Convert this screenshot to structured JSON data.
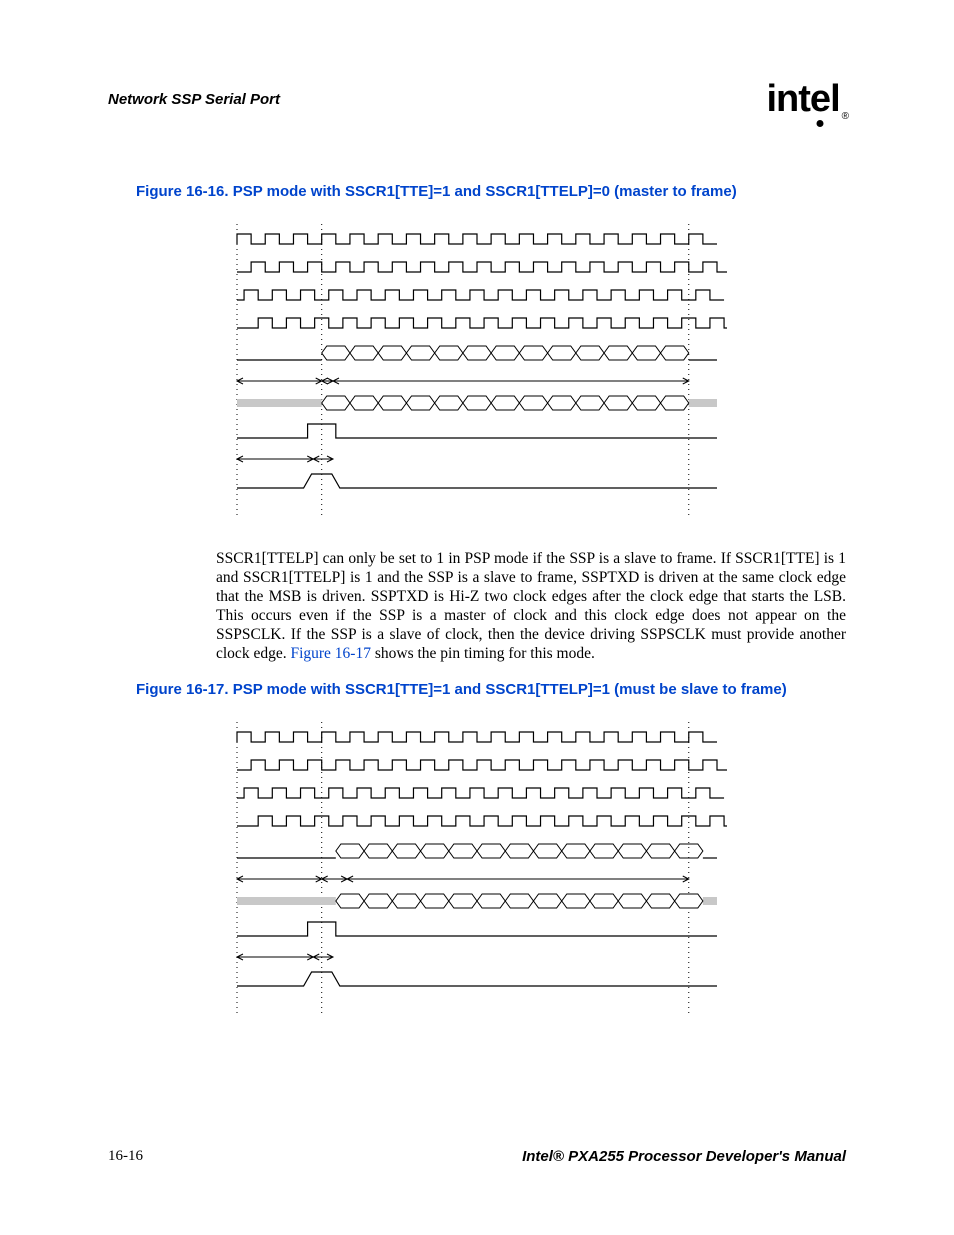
{
  "header": {
    "section_title": "Network SSP Serial Port",
    "logo_text": "intel",
    "logo_reg": "®"
  },
  "figure1": {
    "caption": "Figure 16-16. PSP mode with SSCR1[TTE]=1 and SSCR1[TTELP]=0 (master to frame)"
  },
  "paragraph": {
    "text_before_xref": "SSCR1[TTELP] can only be set to 1 in PSP mode if the SSP is a slave to frame. If SSCR1[TTE] is 1 and SSCR1[TTELP] is 1 and the SSP is a slave to frame, SSPTXD is driven at the same clock edge that the MSB is driven. SSPTXD is Hi-Z two clock edges after the clock edge that starts the LSB. This occurs even if the SSP is a master of clock and this clock edge does not appear on the SSPSCLK. If the SSP is a slave of clock, then the device driving SSPSCLK must provide another clock edge. ",
    "xref": "Figure 16-17",
    "text_after_xref": " shows the pin timing for this mode."
  },
  "figure2": {
    "caption": "Figure 16-17. PSP mode with SSCR1[TTE]=1 and SSCR1[TTELP]=1 (must be slave to frame)"
  },
  "footer": {
    "page_num": "16-16",
    "doc_title": "Intel® PXA255 Processor Developer's Manual"
  },
  "chart_data": [
    {
      "type": "timing-diagram",
      "title": "PSP mode SSCR1[TTE]=1 SSCR1[TTELP]=0 (master to frame)",
      "time_axis_cycles": 17,
      "vertical_guides": [
        0,
        3,
        16
      ],
      "rows": [
        {
          "name": "clock_phase0",
          "type": "clock",
          "phase": 0,
          "cycles": 17
        },
        {
          "name": "clock_phase1",
          "type": "clock",
          "phase": 0.5,
          "cycles": 17
        },
        {
          "name": "clock_phase2",
          "type": "clock",
          "phase": 0.25,
          "cycles": 17
        },
        {
          "name": "clock_phase3",
          "type": "clock",
          "phase": 0.75,
          "cycles": 17
        },
        {
          "name": "data_bus_driven",
          "type": "bus",
          "hi_z_before": 3,
          "data_cells": 13,
          "hi_z_after": 1
        },
        {
          "name": "arrows_a",
          "type": "dimension",
          "segments": [
            [
              0,
              3
            ],
            [
              3,
              3.4
            ],
            [
              3.4,
              16
            ]
          ]
        },
        {
          "name": "data_bus_hiz",
          "type": "bus_tristate",
          "hi_z_before": 3,
          "data_cells": 13,
          "hi_z_after": 1,
          "fill": "#c8c8c8"
        },
        {
          "name": "frame_pulse_a",
          "type": "pulse",
          "start": 2.5,
          "width": 1
        },
        {
          "name": "arrows_b",
          "type": "dimension",
          "segments": [
            [
              0,
              2.7
            ],
            [
              2.7,
              3.4
            ]
          ]
        },
        {
          "name": "frame_pulse_b",
          "type": "pulse_poly",
          "start": 2.5,
          "width": 1
        }
      ]
    },
    {
      "type": "timing-diagram",
      "title": "PSP mode SSCR1[TTE]=1 SSCR1[TTELP]=1 (must be slave to frame)",
      "time_axis_cycles": 17,
      "vertical_guides": [
        0,
        3,
        16
      ],
      "rows": [
        {
          "name": "clock_phase0",
          "type": "clock",
          "phase": 0,
          "cycles": 17
        },
        {
          "name": "clock_phase1",
          "type": "clock",
          "phase": 0.5,
          "cycles": 17
        },
        {
          "name": "clock_phase2",
          "type": "clock",
          "phase": 0.25,
          "cycles": 17
        },
        {
          "name": "clock_phase3",
          "type": "clock",
          "phase": 0.75,
          "cycles": 17
        },
        {
          "name": "data_bus_driven",
          "type": "bus",
          "hi_z_before": 3.5,
          "data_cells": 13,
          "hi_z_after": 0.5
        },
        {
          "name": "arrows_a",
          "type": "dimension",
          "segments": [
            [
              0,
              3
            ],
            [
              3,
              3.9
            ],
            [
              3.9,
              16
            ]
          ]
        },
        {
          "name": "data_bus_hiz",
          "type": "bus_tristate",
          "hi_z_before": 3.5,
          "data_cells": 13,
          "hi_z_after": 0.5,
          "fill": "#c8c8c8"
        },
        {
          "name": "frame_pulse_a",
          "type": "pulse",
          "start": 2.5,
          "width": 1
        },
        {
          "name": "arrows_b",
          "type": "dimension",
          "segments": [
            [
              0,
              2.7
            ],
            [
              2.7,
              3.4
            ]
          ]
        },
        {
          "name": "frame_pulse_b",
          "type": "pulse_poly",
          "start": 2.5,
          "width": 1
        }
      ]
    }
  ]
}
